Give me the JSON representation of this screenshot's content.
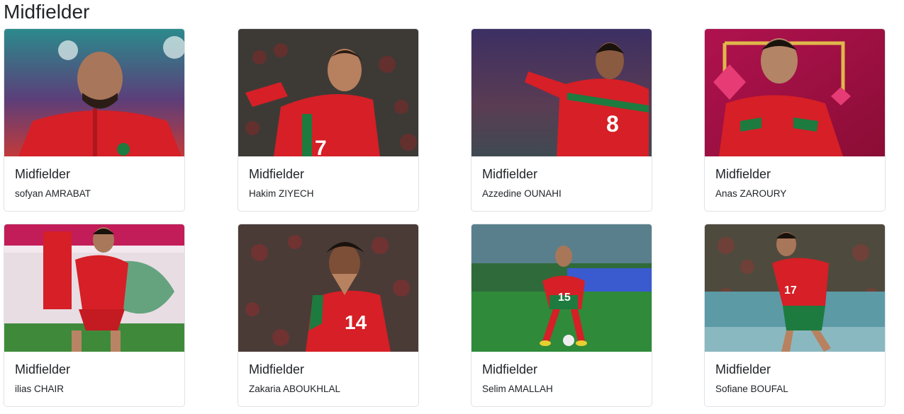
{
  "page": {
    "title": "Midfielder"
  },
  "players": [
    {
      "position": "Midfielder",
      "name": "sofyan AMRABAT",
      "shirt_number": "",
      "photo": "player-photo"
    },
    {
      "position": "Midfielder",
      "name": "Hakim ZIYECH",
      "shirt_number": "7",
      "photo": "player-photo"
    },
    {
      "position": "Midfielder",
      "name": "Azzedine OUNAHI",
      "shirt_number": "8",
      "photo": "player-photo"
    },
    {
      "position": "Midfielder",
      "name": "Anas ZAROURY",
      "shirt_number": "",
      "photo": "player-photo"
    },
    {
      "position": "Midfielder",
      "name": "ilias CHAIR",
      "shirt_number": "",
      "photo": "player-photo"
    },
    {
      "position": "Midfielder",
      "name": "Zakaria ABOUKHLAL",
      "shirt_number": "14",
      "photo": "player-photo"
    },
    {
      "position": "Midfielder",
      "name": "Selim AMALLAH",
      "shirt_number": "15",
      "photo": "player-photo"
    },
    {
      "position": "Midfielder",
      "name": "Sofiane BOUFAL",
      "shirt_number": "17",
      "photo": "player-photo"
    }
  ],
  "colors": {
    "jersey_red": "#d61f26",
    "jersey_green": "#1e7b3f",
    "text": "#212529",
    "border": "#dfe2e6"
  }
}
